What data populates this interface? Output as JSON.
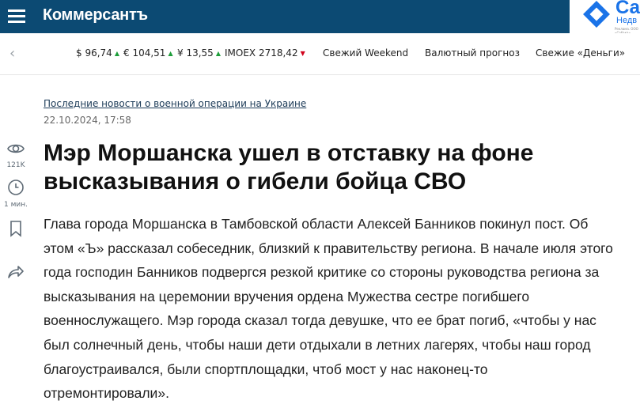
{
  "header": {
    "logo": "Коммерсантъ",
    "promo": {
      "title": "Са",
      "subtitle": "Недв",
      "fine_print": "Реклама. ООО «Собака»"
    }
  },
  "ticker": {
    "quotes": [
      {
        "label": "$ 96,74",
        "trend": "up"
      },
      {
        "label": "€ 104,51",
        "trend": "up"
      },
      {
        "label": "¥ 13,55",
        "trend": "up"
      },
      {
        "label": "IMOEX 2718,42",
        "trend": "down"
      }
    ],
    "links": [
      "Свежий Weekend",
      "Валютный прогноз",
      "Свежие «Деньги»"
    ]
  },
  "sidebar": {
    "views": "121K",
    "read_time": "1 мин."
  },
  "article": {
    "rubric": "Последние новости о военной операции на Украине",
    "date": "22.10.2024, 17:58",
    "title": "Мэр Моршанска ушел в отставку на фоне высказывания о гибели бойца СВО",
    "text": "Глава города Моршанска в Тамбовской области Алексей Банников покинул пост. Об этом «Ъ» рассказал собеседник, близкий к правительству региона. В начале июля этого года господин Банников подвергся резкой критике со стороны руководства региона за высказывания на церемонии вручения ордена Мужества сестре погибшего военнослужащего. Мэр города сказал тогда девушке, что ее брат погиб, «чтобы у нас был солнечный день, чтобы наши дети отдыхали в летних лагерях, чтобы наш город благоустраивался, были спортплощадки, чтоб мост у нас наконец-то отремонтировали»."
  },
  "colors": {
    "header_bg": "#0c4a73",
    "up": "#1e9e3a",
    "down": "#d0021b",
    "promo": "#1a73e8"
  }
}
